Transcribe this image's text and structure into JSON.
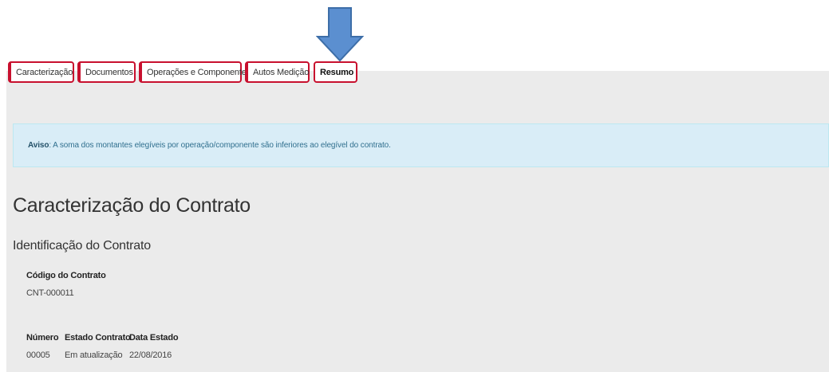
{
  "tabs": [
    {
      "label": "Caracterização",
      "active": false
    },
    {
      "label": "Documentos",
      "active": false
    },
    {
      "label": "Operações e Componentes",
      "active": false
    },
    {
      "label": "Autos Medição",
      "active": false
    },
    {
      "label": "Resumo",
      "active": true
    }
  ],
  "alert": {
    "prefix": "Aviso",
    "message": ": A soma dos montantes elegíveis por operação/componente são inferiores ao elegível do contrato."
  },
  "page_title": "Caracterização do Contrato",
  "section_title": "Identificação do Contrato",
  "fields": {
    "codigo": {
      "label": "Código do Contrato",
      "value": "CNT-000011"
    },
    "numero": {
      "label": "Número",
      "value": "00005"
    },
    "estado": {
      "label": "Estado Contrato",
      "value": "Em atualização"
    },
    "data_estado": {
      "label": "Data Estado",
      "value": "22/08/2016"
    }
  },
  "colors": {
    "tab_border": "#c8102e",
    "alert_bg": "#d9edf7",
    "arrow": "#5b8fd0"
  },
  "icons": {
    "pointer": "down-arrow-icon"
  }
}
